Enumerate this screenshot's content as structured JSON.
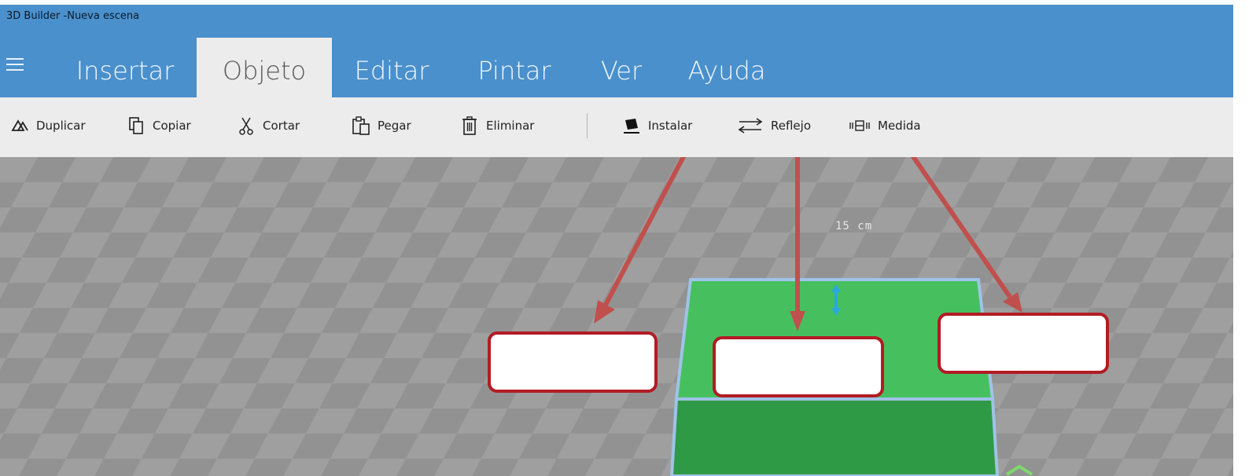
{
  "window": {
    "title": "3D Builder -Nueva escena"
  },
  "menu": {
    "hamburger_icon": "menu-icon",
    "tabs": [
      {
        "label": "Insertar",
        "active": false
      },
      {
        "label": "Objeto",
        "active": true
      },
      {
        "label": "Editar",
        "active": false
      },
      {
        "label": "Pintar",
        "active": false
      },
      {
        "label": "Ver",
        "active": false
      },
      {
        "label": "Ayuda",
        "active": false
      }
    ]
  },
  "toolbar": {
    "items": [
      {
        "label": "Duplicar",
        "icon": "duplicate-icon"
      },
      {
        "label": "Copiar",
        "icon": "copy-icon"
      },
      {
        "label": "Cortar",
        "icon": "scissors-icon"
      },
      {
        "label": "Pegar",
        "icon": "paste-icon"
      },
      {
        "label": "Eliminar",
        "icon": "trash-icon"
      },
      {
        "label": "Instalar",
        "icon": "settle-icon"
      },
      {
        "label": "Reflejo",
        "icon": "mirror-icon"
      },
      {
        "label": "Medida",
        "icon": "measure-icon"
      }
    ]
  },
  "scene": {
    "dimension_label": "15 cm",
    "object_color_top": "#46c05e",
    "object_color_front": "#2f9a46",
    "selection_outline_color": "#9fc3e8",
    "arrow_color": "#c0504d"
  },
  "colors": {
    "titlebar": "#4a90cc",
    "toolbar": "#ececec",
    "box_border": "#b21c24"
  }
}
